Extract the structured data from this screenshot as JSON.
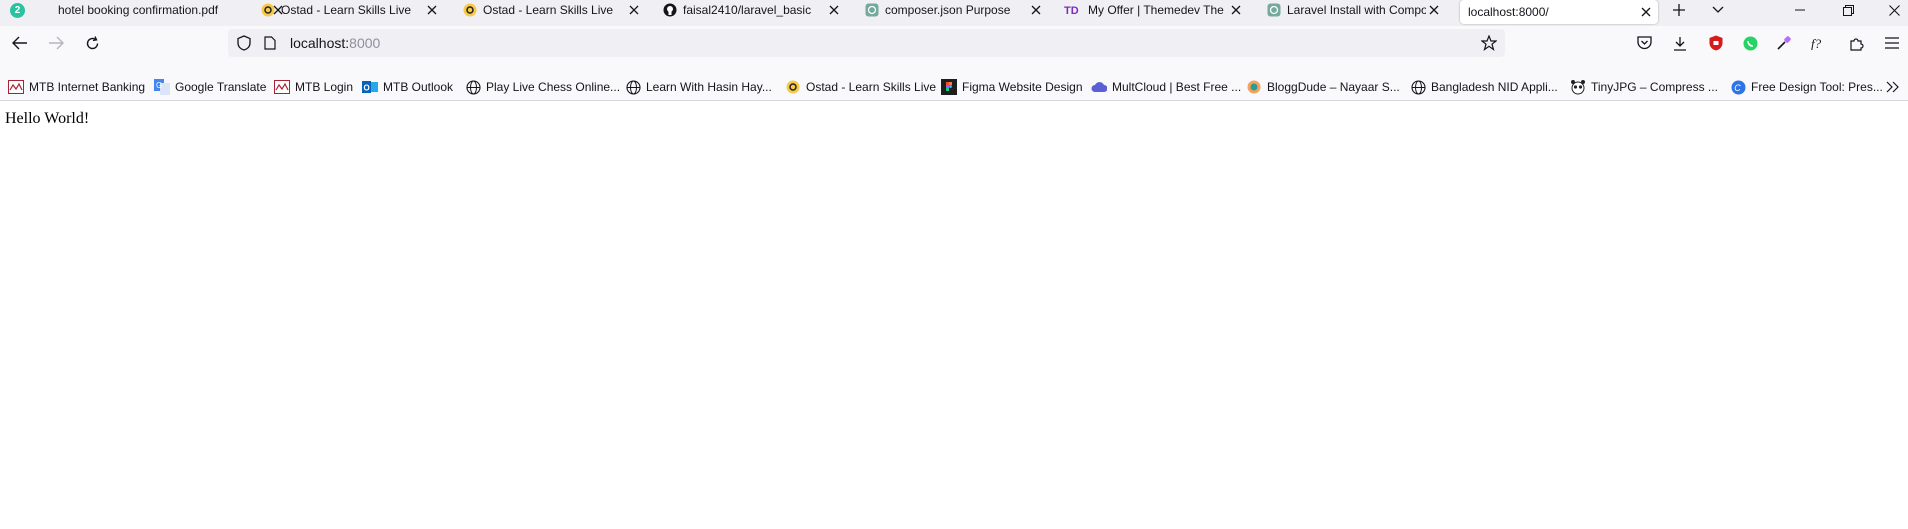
{
  "tabbar": {
    "badge_count": "2",
    "tabs": [
      {
        "title": "hotel booking confirmation.pdf",
        "icon": "pdf-icon"
      },
      {
        "title": "Ostad - Learn Skills Live",
        "icon": "ostad-icon"
      },
      {
        "title": "Ostad - Learn Skills Live",
        "icon": "ostad-icon"
      },
      {
        "title": "faisal2410/laravel_basic",
        "icon": "github-icon"
      },
      {
        "title": "composer.json Purpose",
        "icon": "chatgpt-icon"
      },
      {
        "title": "My Offer | Themedev The B",
        "icon": "themedev-icon"
      },
      {
        "title": "Laravel Install with Compo",
        "icon": "chatgpt-icon"
      },
      {
        "title": "localhost:8000/",
        "icon": "none"
      }
    ]
  },
  "navbar": {
    "url_host": "localhost:",
    "url_port": "8000"
  },
  "bookmarks": [
    {
      "label": "MTB Internet Banking",
      "icon": "mtb-icon"
    },
    {
      "label": "Google Translate",
      "icon": "google-translate-icon"
    },
    {
      "label": "MTB Login",
      "icon": "mtb-icon"
    },
    {
      "label": "MTB Outlook",
      "icon": "outlook-icon"
    },
    {
      "label": "Play Live Chess Online...",
      "icon": "globe-icon"
    },
    {
      "label": "Learn With Hasin Hay...",
      "icon": "globe-icon"
    },
    {
      "label": "Ostad - Learn Skills Live",
      "icon": "ostad-icon"
    },
    {
      "label": "Figma Website Design",
      "icon": "figma-icon"
    },
    {
      "label": "MultCloud | Best Free ...",
      "icon": "multcloud-icon"
    },
    {
      "label": "BloggDude – Nayaar S...",
      "icon": "bloggdude-icon"
    },
    {
      "label": "Bangladesh NID Appli...",
      "icon": "globe-icon"
    },
    {
      "label": "TinyJPG – Compress ...",
      "icon": "tinyjpg-icon"
    },
    {
      "label": "Free Design Tool: Pres...",
      "icon": "canva-icon"
    }
  ],
  "page": {
    "content": "Hello World!"
  }
}
